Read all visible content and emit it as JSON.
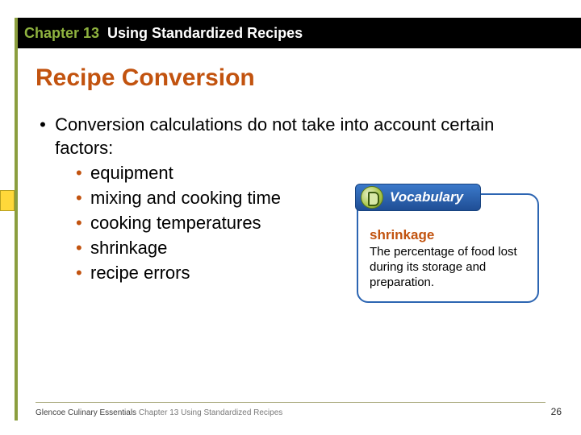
{
  "header": {
    "chapter_label": "Chapter 13",
    "chapter_title": "Using Standardized Recipes"
  },
  "slide": {
    "title": "Recipe Conversion",
    "lead": "Conversion calculations do not take into account certain factors:",
    "bullets": [
      "equipment",
      "mixing and cooking time",
      "cooking temperatures",
      "shrinkage",
      "recipe errors"
    ]
  },
  "vocab": {
    "tab_label": "Vocabulary",
    "term": "shrinkage",
    "definition": "The percentage of food lost during its storage and preparation."
  },
  "footer": {
    "publisher": "Glencoe Culinary Essentials",
    "context": "Chapter 13 Using Standardized Recipes",
    "page": "26"
  }
}
